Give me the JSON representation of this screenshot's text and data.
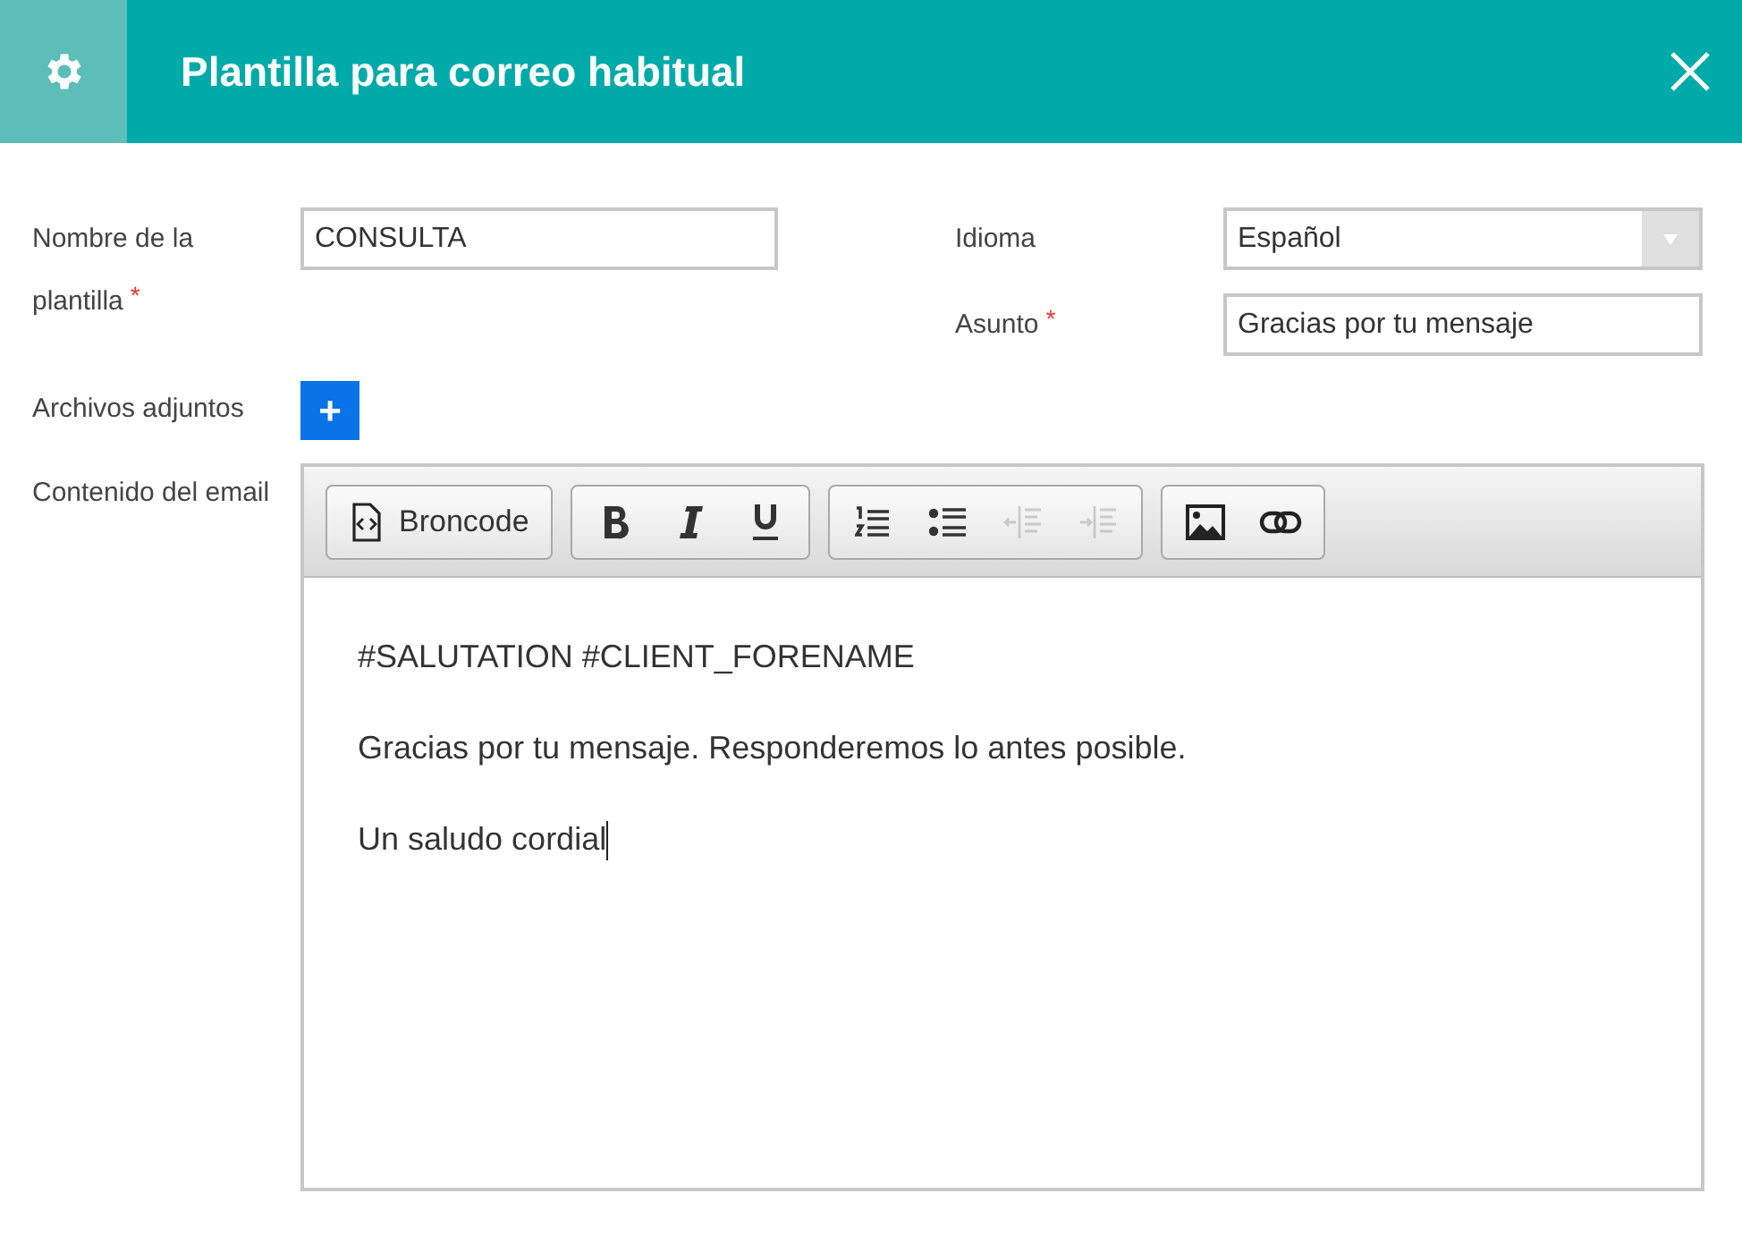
{
  "header": {
    "title": "Plantilla para correo habitual"
  },
  "left_fields": [
    {
      "label": "Nombre de la plantilla",
      "required_mark": "*",
      "kind": "text",
      "value": "CONSULTA"
    }
  ],
  "right_fields": [
    {
      "label": "Idioma",
      "kind": "select",
      "value": "Español"
    },
    {
      "label": "Asunto",
      "required_mark": "*",
      "kind": "text",
      "value": "Gracias por tu mensaje"
    }
  ],
  "attachments": {
    "label": "Archivos adjuntos",
    "button": "+"
  },
  "editor": {
    "label": "Contenido del email",
    "toolbar": [
      [
        {
          "kind": "source",
          "label": "Broncode",
          "disabled": false
        }
      ],
      [
        {
          "kind": "bold",
          "disabled": false
        },
        {
          "kind": "italic",
          "disabled": false
        },
        {
          "kind": "underline",
          "disabled": false
        }
      ],
      [
        {
          "kind": "numbered-list",
          "disabled": false
        },
        {
          "kind": "bulleted-list",
          "disabled": false
        },
        {
          "kind": "outdent",
          "disabled": true
        },
        {
          "kind": "indent",
          "disabled": true
        }
      ],
      [
        {
          "kind": "image",
          "disabled": false
        },
        {
          "kind": "link",
          "disabled": false
        }
      ]
    ],
    "paragraphs": [
      "#SALUTATION #CLIENT_FORENAME",
      "Gracias por tu mensaje. Responderemos lo antes posible.",
      "Un saludo cordial"
    ]
  }
}
